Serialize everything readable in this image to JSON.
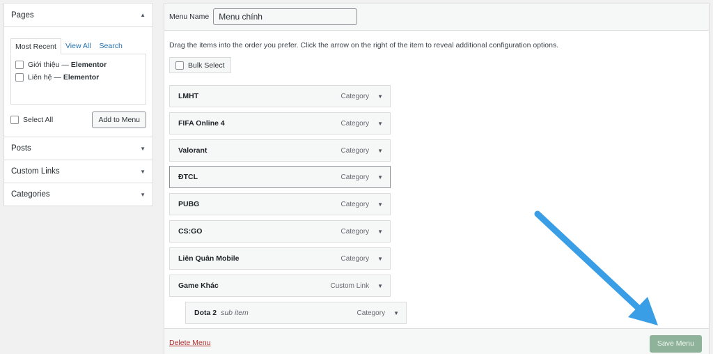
{
  "left_panel": {
    "pages": {
      "title": "Pages",
      "tabs": [
        "Most Recent",
        "View All",
        "Search"
      ],
      "items": [
        {
          "label": "Giới thiệu —",
          "bold": "Elementor"
        },
        {
          "label": "Liên hệ —",
          "bold": "Elementor"
        }
      ],
      "select_all": "Select All",
      "add_button": "Add to Menu"
    },
    "sections": [
      "Posts",
      "Custom Links",
      "Categories"
    ]
  },
  "main": {
    "menu_name_label": "Menu Name",
    "menu_name_value": "Menu chính",
    "instructions": "Drag the items into the order you prefer. Click the arrow on the right of the item to reveal additional configuration options.",
    "bulk_select": "Bulk Select",
    "items": [
      {
        "title": "LMHT",
        "type": "Category"
      },
      {
        "title": "FIFA Online 4",
        "type": "Category"
      },
      {
        "title": "Valorant",
        "type": "Category"
      },
      {
        "title": "ĐTCL",
        "type": "Category"
      },
      {
        "title": "PUBG",
        "type": "Category"
      },
      {
        "title": "CS:GO",
        "type": "Category"
      },
      {
        "title": "Liên Quân Mobile",
        "type": "Category"
      },
      {
        "title": "Game Khác",
        "type": "Custom Link"
      },
      {
        "title": "Dota 2",
        "subtitle": "sub item",
        "type": "Category"
      }
    ],
    "delete_menu": "Delete Menu",
    "save_menu": "Save Menu"
  },
  "colors": {
    "link": "#2271b1",
    "delete": "#b32d2e",
    "save_button": "#8fb39a",
    "annotation_arrow": "#3a9ee6"
  },
  "icons": [
    "caret-up-icon",
    "caret-down-icon",
    "checkbox-icon",
    "annotation-arrow-icon"
  ]
}
